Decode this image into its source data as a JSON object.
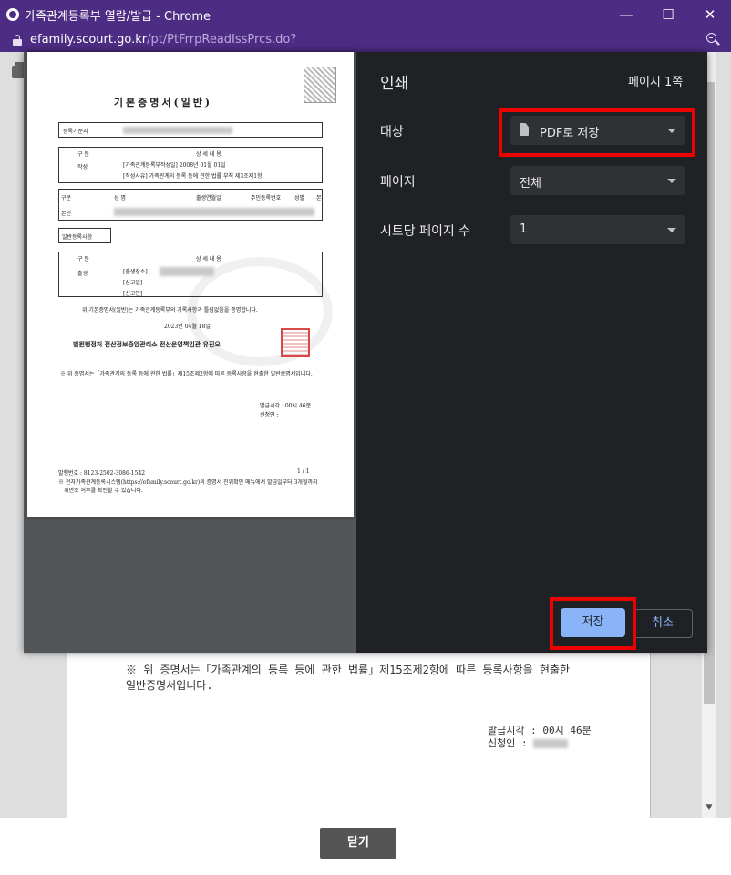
{
  "window": {
    "title": "가족관계등록부 열람/발급 - Chrome",
    "minimize": "—",
    "maximize": "☐",
    "close": "✕"
  },
  "address": {
    "host": "efamily.scourt.go.kr",
    "path": "/pt/PtFrrpReadIssPrcs.do?"
  },
  "background_page": {
    "note_line1": "※ 위 증명서는「가족관계의 등록 등에 관한 법률」제15조제2항에 따른 등록사항을 현출한",
    "note_line2": "일반증명서입니다.",
    "issue_time": "발급시각 : 00시 46분",
    "applicant_label": "신청인 :",
    "close_button": "닫기"
  },
  "preview": {
    "doc_title": "기본증명서(일반)",
    "reg_base_label": "등록기준지",
    "section_label": "구 분",
    "detail_label": "상 세 내 용",
    "created_label": "작성",
    "created_line1": "[가족관계등록부작성일]      2008년 01월 01일",
    "created_line2": "[작성사유]   가족관계의 등록 등에 관한 법률 부칙 제3조제1항",
    "col_section": "구분",
    "col_name": "성        명",
    "col_birth": "출생연월일",
    "col_rrn": "주민등록번호",
    "col_gender": "성별",
    "col_origin": "본",
    "self_label": "본인",
    "general_label": "일반등록사항",
    "birth_label": "출생",
    "birth_place": "[출생장소]",
    "report_date": "[신고일]",
    "reporter": "[신고인]",
    "cert_statement": "위 기본증명서(일반)는 가족관계등록부의 기록사항과 틀림없음을 증명합니다.",
    "issue_date": "2023년 04월 18일",
    "issuer": "법원행정처 전산정보중앙관리소 전산운영책임관 유진오",
    "note": "※ 위 증명서는「가족관계의 등록 등에 관한 법률」제15조제2항에 따른 등록사항을 현출한 일반증명서입니다.",
    "issue_time": "발급시각 : 00시 46분",
    "applicant": "신청인 :",
    "issue_no": "발행번호 : 8123-2502-3086-1542",
    "page_no": "1 / 1",
    "footer_note1": "※ 전자가족관계등록시스템(https://efamily.scourt.go.kr)의 증명서 진위확인 메뉴에서 발급일부터 3개월까지",
    "footer_note2": "위변조 여부를 확인할 수 있습니다."
  },
  "print_panel": {
    "title": "인쇄",
    "page_count": "페이지 1쪽",
    "destination_label": "대상",
    "destination_value": "PDF로 저장",
    "pages_label": "페이지",
    "pages_value": "전체",
    "per_sheet_label": "시트당 페이지 수",
    "per_sheet_value": "1",
    "save_button": "저장",
    "cancel_button": "취소"
  },
  "colors": {
    "titlebar": "#4d2d83",
    "dialog_bg": "#202124",
    "select_bg": "#303134",
    "save_bg": "#8ab4f8",
    "highlight": "#ee0000"
  }
}
